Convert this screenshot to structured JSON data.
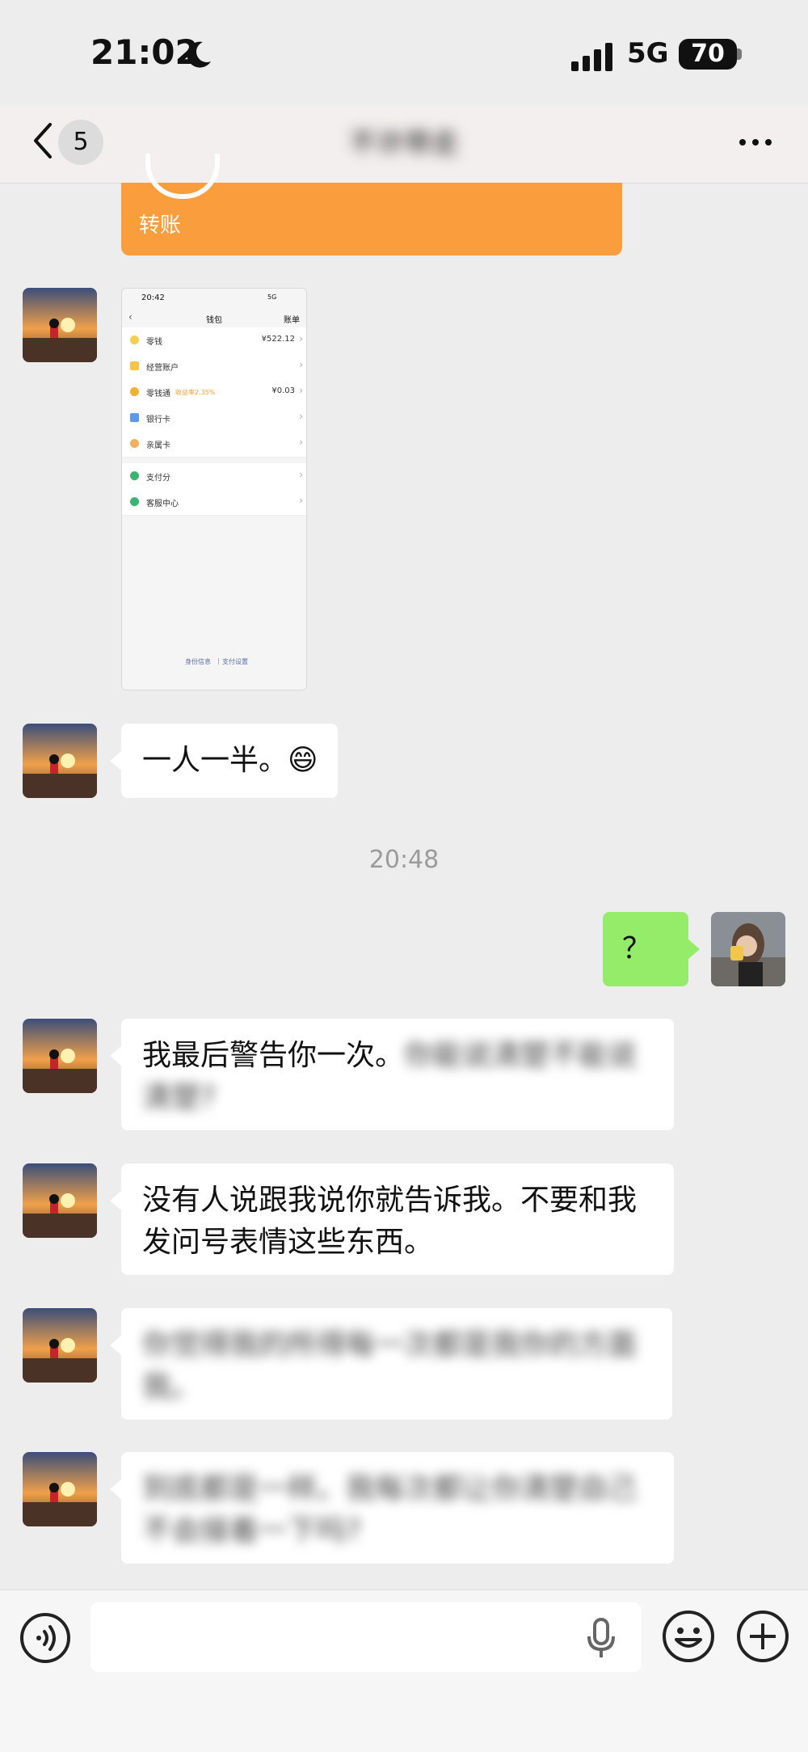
{
  "status_bar": {
    "time": "21:02",
    "network": "5G",
    "battery": "70"
  },
  "nav": {
    "unread_count": "5",
    "title": "不许带走"
  },
  "transfer_card": {
    "label": "转账"
  },
  "wallet_screenshot": {
    "time": "20:42",
    "network": "5G",
    "title": "钱包",
    "right": "账单",
    "rows": [
      {
        "label": "零钱",
        "value": "¥522.12"
      },
      {
        "label": "经营账户",
        "value": ""
      },
      {
        "label": "零钱通",
        "note": "收益率2.35%",
        "value": "¥0.03"
      },
      {
        "label": "银行卡",
        "value": ""
      },
      {
        "label": "亲属卡",
        "value": ""
      }
    ],
    "rows2": [
      {
        "label": "支付分"
      },
      {
        "label": "客服中心"
      }
    ],
    "footer": [
      "身份信息",
      "支付设置"
    ]
  },
  "messages": [
    {
      "sender": "other",
      "text": "一人一半。😄"
    },
    {
      "sender": "timestamp",
      "text": "20:48"
    },
    {
      "sender": "me",
      "text": "？"
    },
    {
      "sender": "other",
      "text_clear": "我最后警告你一次。",
      "text_blurred": "你能说清楚不能说清楚?"
    },
    {
      "sender": "other",
      "text": "没有人说跟我说你就告诉我。不要和我发问号表情这些东西。"
    },
    {
      "sender": "other",
      "text_blurred": "你觉得我的所得每一次都是我你的方面我。"
    },
    {
      "sender": "other",
      "text_blurred": "到底都是一样。我每次都让你清楚自己不会接着一下吗?"
    }
  ],
  "colors": {
    "chat_bg": "#ededed",
    "my_bubble": "#95ec69",
    "transfer": "#f99d3d"
  },
  "icons": [
    "back-chevron-icon",
    "more-dots-icon",
    "voice-toggle-icon",
    "microphone-icon",
    "emoji-icon",
    "plus-icon",
    "moon-icon",
    "signal-icon"
  ]
}
